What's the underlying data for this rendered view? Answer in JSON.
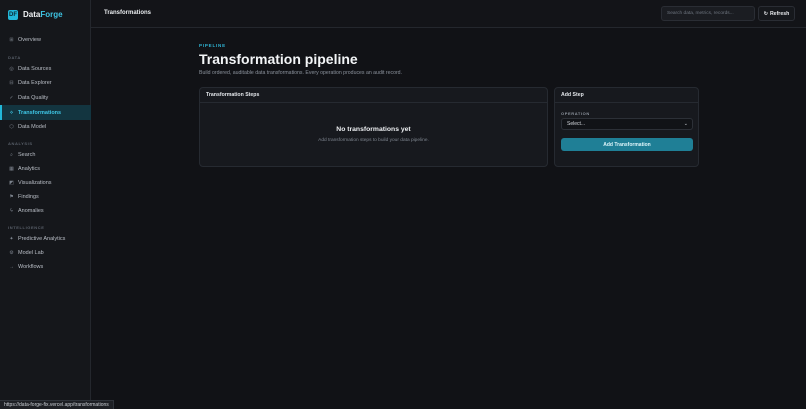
{
  "app": {
    "brand_part1": "Data",
    "brand_part2": "Forge",
    "logo_glyph": "DF"
  },
  "sidebar": {
    "top_item": {
      "label": "Overview",
      "icon": "grid-icon"
    },
    "sections": [
      {
        "label": "DATA",
        "items": [
          {
            "label": "Data Sources",
            "icon": "database-icon"
          },
          {
            "label": "Data Explorer",
            "icon": "table-icon"
          },
          {
            "label": "Data Quality",
            "icon": "check-icon"
          },
          {
            "label": "Transformations",
            "icon": "transform-icon",
            "active": true
          },
          {
            "label": "Data Model",
            "icon": "model-icon"
          }
        ]
      },
      {
        "label": "ANALYSIS",
        "items": [
          {
            "label": "Search",
            "icon": "search-icon"
          },
          {
            "label": "Analytics",
            "icon": "analytics-icon"
          },
          {
            "label": "Visualizations",
            "icon": "chart-icon"
          },
          {
            "label": "Findings",
            "icon": "flag-icon"
          },
          {
            "label": "Anomalies",
            "icon": "bolt-icon"
          }
        ]
      },
      {
        "label": "INTELLIGENCE",
        "items": [
          {
            "label": "Predictive Analytics",
            "icon": "sparkle-icon"
          },
          {
            "label": "Model Lab",
            "icon": "gear-icon"
          },
          {
            "label": "Workflows",
            "icon": "arrow-icon"
          }
        ]
      }
    ]
  },
  "topbar": {
    "title": "Transformations",
    "search_placeholder": "Search data, metrics, records...",
    "refresh_label": "Refresh"
  },
  "page": {
    "kicker": "PIPELINE",
    "title": "Transformation pipeline",
    "subtitle": "Build ordered, auditable data transformations. Every operation produces an audit record."
  },
  "steps_card": {
    "title": "Transformation Steps",
    "empty_title": "No transformations yet",
    "empty_subtitle": "Add transformation steps to build your data pipeline."
  },
  "add_card": {
    "title": "Add Step",
    "field_label": "OPERATION",
    "select_value": "Select...",
    "button_label": "Add Transformation"
  },
  "status_url": "https://data-forge-fix.vercel.app/transformations",
  "colors": {
    "accent": "#22b8d9",
    "button": "#1f7f96",
    "background": "#111216"
  }
}
